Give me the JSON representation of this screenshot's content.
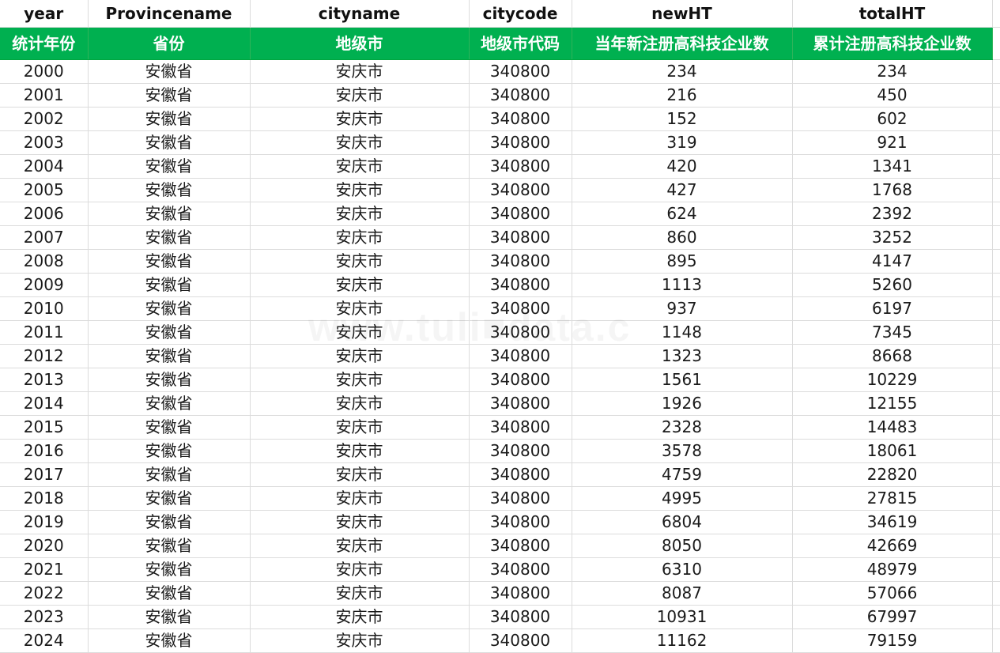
{
  "columns_en": [
    "year",
    "Provincename",
    "cityname",
    "citycode",
    "newHT",
    "totalHT"
  ],
  "columns_cn": [
    "统计年份",
    "省份",
    "地级市",
    "地级市代码",
    "当年新注册高科技企业数",
    "累计注册高科技企业数"
  ],
  "rows": [
    [
      "2000",
      "安徽省",
      "安庆市",
      "340800",
      "234",
      "234"
    ],
    [
      "2001",
      "安徽省",
      "安庆市",
      "340800",
      "216",
      "450"
    ],
    [
      "2002",
      "安徽省",
      "安庆市",
      "340800",
      "152",
      "602"
    ],
    [
      "2003",
      "安徽省",
      "安庆市",
      "340800",
      "319",
      "921"
    ],
    [
      "2004",
      "安徽省",
      "安庆市",
      "340800",
      "420",
      "1341"
    ],
    [
      "2005",
      "安徽省",
      "安庆市",
      "340800",
      "427",
      "1768"
    ],
    [
      "2006",
      "安徽省",
      "安庆市",
      "340800",
      "624",
      "2392"
    ],
    [
      "2007",
      "安徽省",
      "安庆市",
      "340800",
      "860",
      "3252"
    ],
    [
      "2008",
      "安徽省",
      "安庆市",
      "340800",
      "895",
      "4147"
    ],
    [
      "2009",
      "安徽省",
      "安庆市",
      "340800",
      "1113",
      "5260"
    ],
    [
      "2010",
      "安徽省",
      "安庆市",
      "340800",
      "937",
      "6197"
    ],
    [
      "2011",
      "安徽省",
      "安庆市",
      "340800",
      "1148",
      "7345"
    ],
    [
      "2012",
      "安徽省",
      "安庆市",
      "340800",
      "1323",
      "8668"
    ],
    [
      "2013",
      "安徽省",
      "安庆市",
      "340800",
      "1561",
      "10229"
    ],
    [
      "2014",
      "安徽省",
      "安庆市",
      "340800",
      "1926",
      "12155"
    ],
    [
      "2015",
      "安徽省",
      "安庆市",
      "340800",
      "2328",
      "14483"
    ],
    [
      "2016",
      "安徽省",
      "安庆市",
      "340800",
      "3578",
      "18061"
    ],
    [
      "2017",
      "安徽省",
      "安庆市",
      "340800",
      "4759",
      "22820"
    ],
    [
      "2018",
      "安徽省",
      "安庆市",
      "340800",
      "4995",
      "27815"
    ],
    [
      "2019",
      "安徽省",
      "安庆市",
      "340800",
      "6804",
      "34619"
    ],
    [
      "2020",
      "安徽省",
      "安庆市",
      "340800",
      "8050",
      "42669"
    ],
    [
      "2021",
      "安徽省",
      "安庆市",
      "340800",
      "6310",
      "48979"
    ],
    [
      "2022",
      "安徽省",
      "安庆市",
      "340800",
      "8087",
      "57066"
    ],
    [
      "2023",
      "安徽省",
      "安庆市",
      "340800",
      "10931",
      "67997"
    ],
    [
      "2024",
      "安徽省",
      "安庆市",
      "340800",
      "11162",
      "79159"
    ]
  ],
  "watermark": "www.tuli■data.c",
  "colors": {
    "header_fill": "#00b050",
    "header_text": "#ffffff",
    "grid_line": "#dcdcdc"
  }
}
